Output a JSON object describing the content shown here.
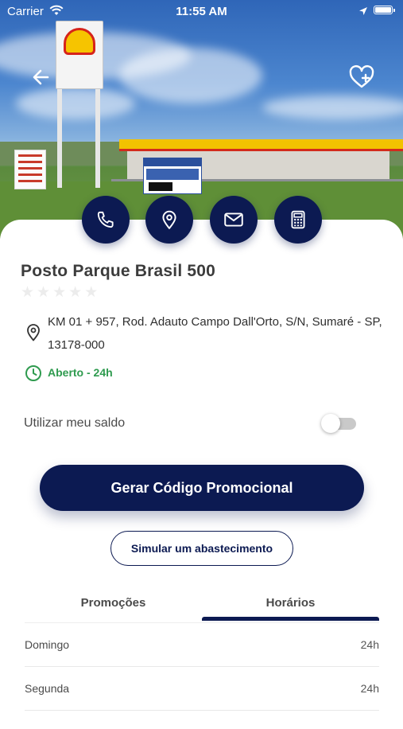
{
  "status_bar": {
    "carrier": "Carrier",
    "time": "11:55 AM"
  },
  "header": {
    "back_icon": "arrow-left-icon",
    "favorite_icon": "heart-plus-icon"
  },
  "quick_actions": [
    {
      "name": "call",
      "icon": "phone-icon"
    },
    {
      "name": "map",
      "icon": "map-pin-icon"
    },
    {
      "name": "email",
      "icon": "envelope-icon"
    },
    {
      "name": "calculator",
      "icon": "calculator-icon"
    }
  ],
  "station": {
    "name": "Posto Parque Brasil 500",
    "rating": 0,
    "rating_max": 5,
    "address": "KM 01 + 957, Rod. Adauto Campo Dall'Orto, S/N, Sumaré - SP, 13178-000",
    "hours_status": "Aberto - 24h"
  },
  "balance": {
    "label": "Utilizar meu saldo",
    "enabled": false
  },
  "buttons": {
    "generate_code": "Gerar Código Promocional",
    "simulate": "Simular um abastecimento"
  },
  "tabs": [
    {
      "label": "Promoções",
      "active": false
    },
    {
      "label": "Horários",
      "active": true
    }
  ],
  "schedule": [
    {
      "day": "Domingo",
      "hours": "24h"
    },
    {
      "day": "Segunda",
      "hours": "24h"
    }
  ],
  "colors": {
    "primary": "#0c1a52",
    "open_green": "#2f9b4f",
    "text": "#3c3c3c"
  }
}
